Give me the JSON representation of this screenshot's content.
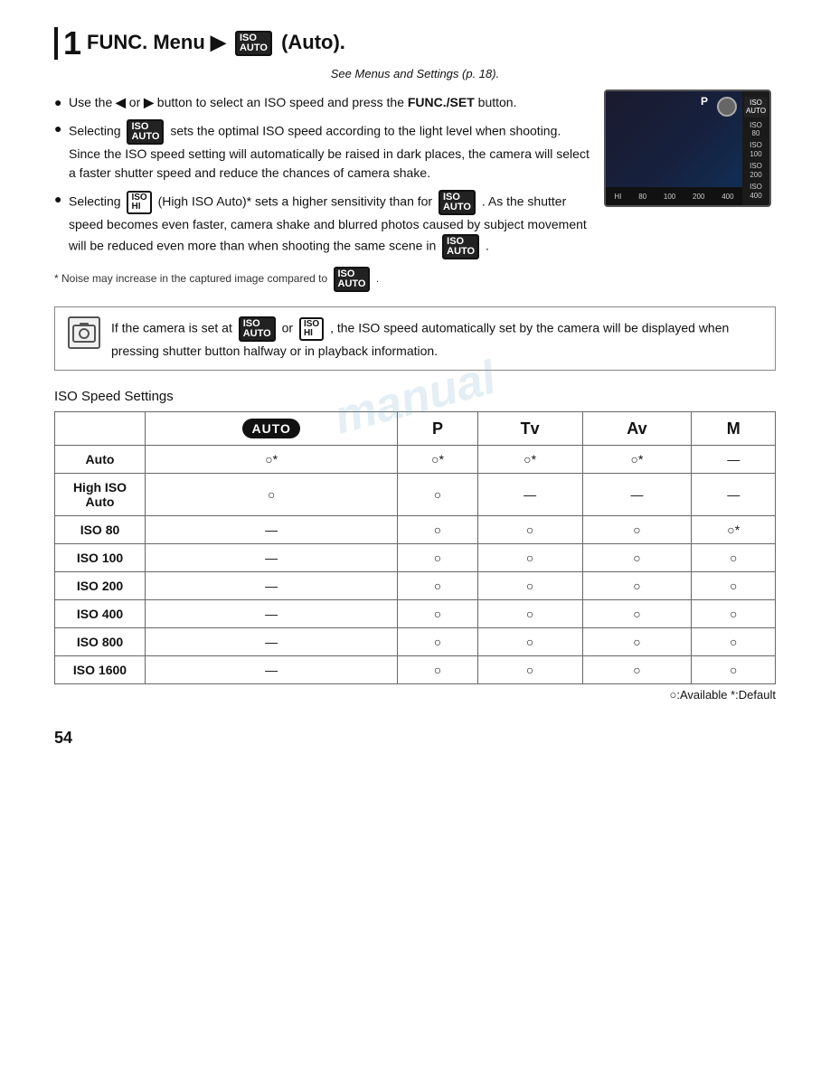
{
  "page": {
    "step_number": "1",
    "step_title_prefix": "FUNC. Menu",
    "step_title_suffix": "(Auto).",
    "see_menus": "See Menus and Settings (p. 18).",
    "bullets": [
      {
        "id": "bullet1",
        "text_prefix": "Use the",
        "text_middle": "button to select an ISO speed and press the",
        "text_bold": "FUNC./SET",
        "text_suffix": "button.",
        "has_arrows": true
      },
      {
        "id": "bullet2",
        "text_prefix": "Selecting",
        "badge_type": "auto",
        "text_suffix": "sets the optimal ISO speed according to the light level when shooting. Since the ISO speed setting will automatically be raised in dark places, the camera will select a faster shutter speed and reduce the chances of camera shake."
      },
      {
        "id": "bullet3",
        "text_prefix": "Selecting",
        "badge_type": "hi",
        "badge_label": "ISO HI",
        "text_middle": "(High ISO Auto)* sets a higher sensitivity than for",
        "badge2_type": "auto",
        "text_suffix": ". As the shutter speed becomes even faster, camera shake and blurred photos caused by subject movement will be reduced even more than when shooting the same scene in",
        "badge3_type": "auto",
        "text_end": "."
      }
    ],
    "footnote": "* Noise may increase in the captured image compared to",
    "footnote_end": ".",
    "note_box": {
      "text": "If the camera is set at",
      "middle": "or",
      "text2": ", the ISO speed automatically set by the camera will be displayed when pressing shutter button halfway or in playback information."
    },
    "table_title": "ISO Speed Settings",
    "table_headers": [
      "",
      "AUTO",
      "P",
      "Tv",
      "Av",
      "M"
    ],
    "table_rows": [
      {
        "label": "Auto",
        "auto": "○*",
        "P": "○*",
        "Tv": "○*",
        "Av": "○*",
        "M": "—"
      },
      {
        "label": "High ISO Auto",
        "auto": "○",
        "P": "○",
        "Tv": "—",
        "Av": "—",
        "M": "—"
      },
      {
        "label": "ISO 80",
        "auto": "—",
        "P": "○",
        "Tv": "○",
        "Av": "○",
        "M": "○*"
      },
      {
        "label": "ISO 100",
        "auto": "—",
        "P": "○",
        "Tv": "○",
        "Av": "○",
        "M": "○"
      },
      {
        "label": "ISO 200",
        "auto": "—",
        "P": "○",
        "Tv": "○",
        "Av": "○",
        "M": "○"
      },
      {
        "label": "ISO 400",
        "auto": "—",
        "P": "○",
        "Tv": "○",
        "Av": "○",
        "M": "○"
      },
      {
        "label": "ISO 800",
        "auto": "—",
        "P": "○",
        "Tv": "○",
        "Av": "○",
        "M": "○"
      },
      {
        "label": "ISO 1600",
        "auto": "—",
        "P": "○",
        "Tv": "○",
        "Av": "○",
        "M": "○"
      }
    ],
    "table_footer": "○:Available  *:Default",
    "page_number": "54",
    "sidebar_items": [
      "AUTO",
      "ISO\n80",
      "ISO\n100",
      "ISO\n200",
      "ISO\n400"
    ],
    "bottom_bar_items": [
      "HI",
      "80",
      "100",
      "200",
      "400"
    ]
  }
}
